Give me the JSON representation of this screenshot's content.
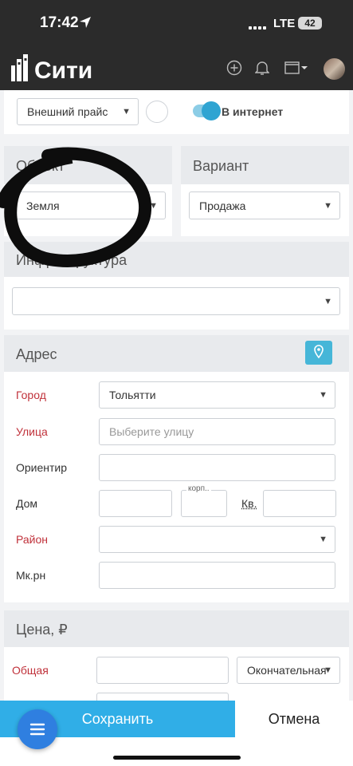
{
  "status_bar": {
    "time": "17:42",
    "network": "LTE",
    "battery": "42"
  },
  "header": {
    "app_name": "Сити"
  },
  "top_row": {
    "price_select_value": "Внешний прайс",
    "internet_label": "В интернет"
  },
  "object_section": {
    "title": "Объект",
    "value": "Земля"
  },
  "variant_section": {
    "title": "Вариант",
    "value": "Продажа"
  },
  "infrastructure_section": {
    "title": "Инфраструктура",
    "value": ""
  },
  "address_section": {
    "title": "Адрес",
    "city_label": "Город",
    "city_value": "Тольятти",
    "street_label": "Улица",
    "street_placeholder": "Выберите улицу",
    "landmark_label": "Ориентир",
    "house_label": "Дом",
    "building_label": "корп..",
    "apartment_label": "Кв.",
    "district_label": "Район",
    "microdistrict_label": "Мк.рн"
  },
  "price_section": {
    "title": "Цена, ₽",
    "total_label": "Общая",
    "price_type_value": "Окончательная"
  },
  "bottom_bar": {
    "save_label": "Сохранить",
    "cancel_label": "Отмена"
  }
}
